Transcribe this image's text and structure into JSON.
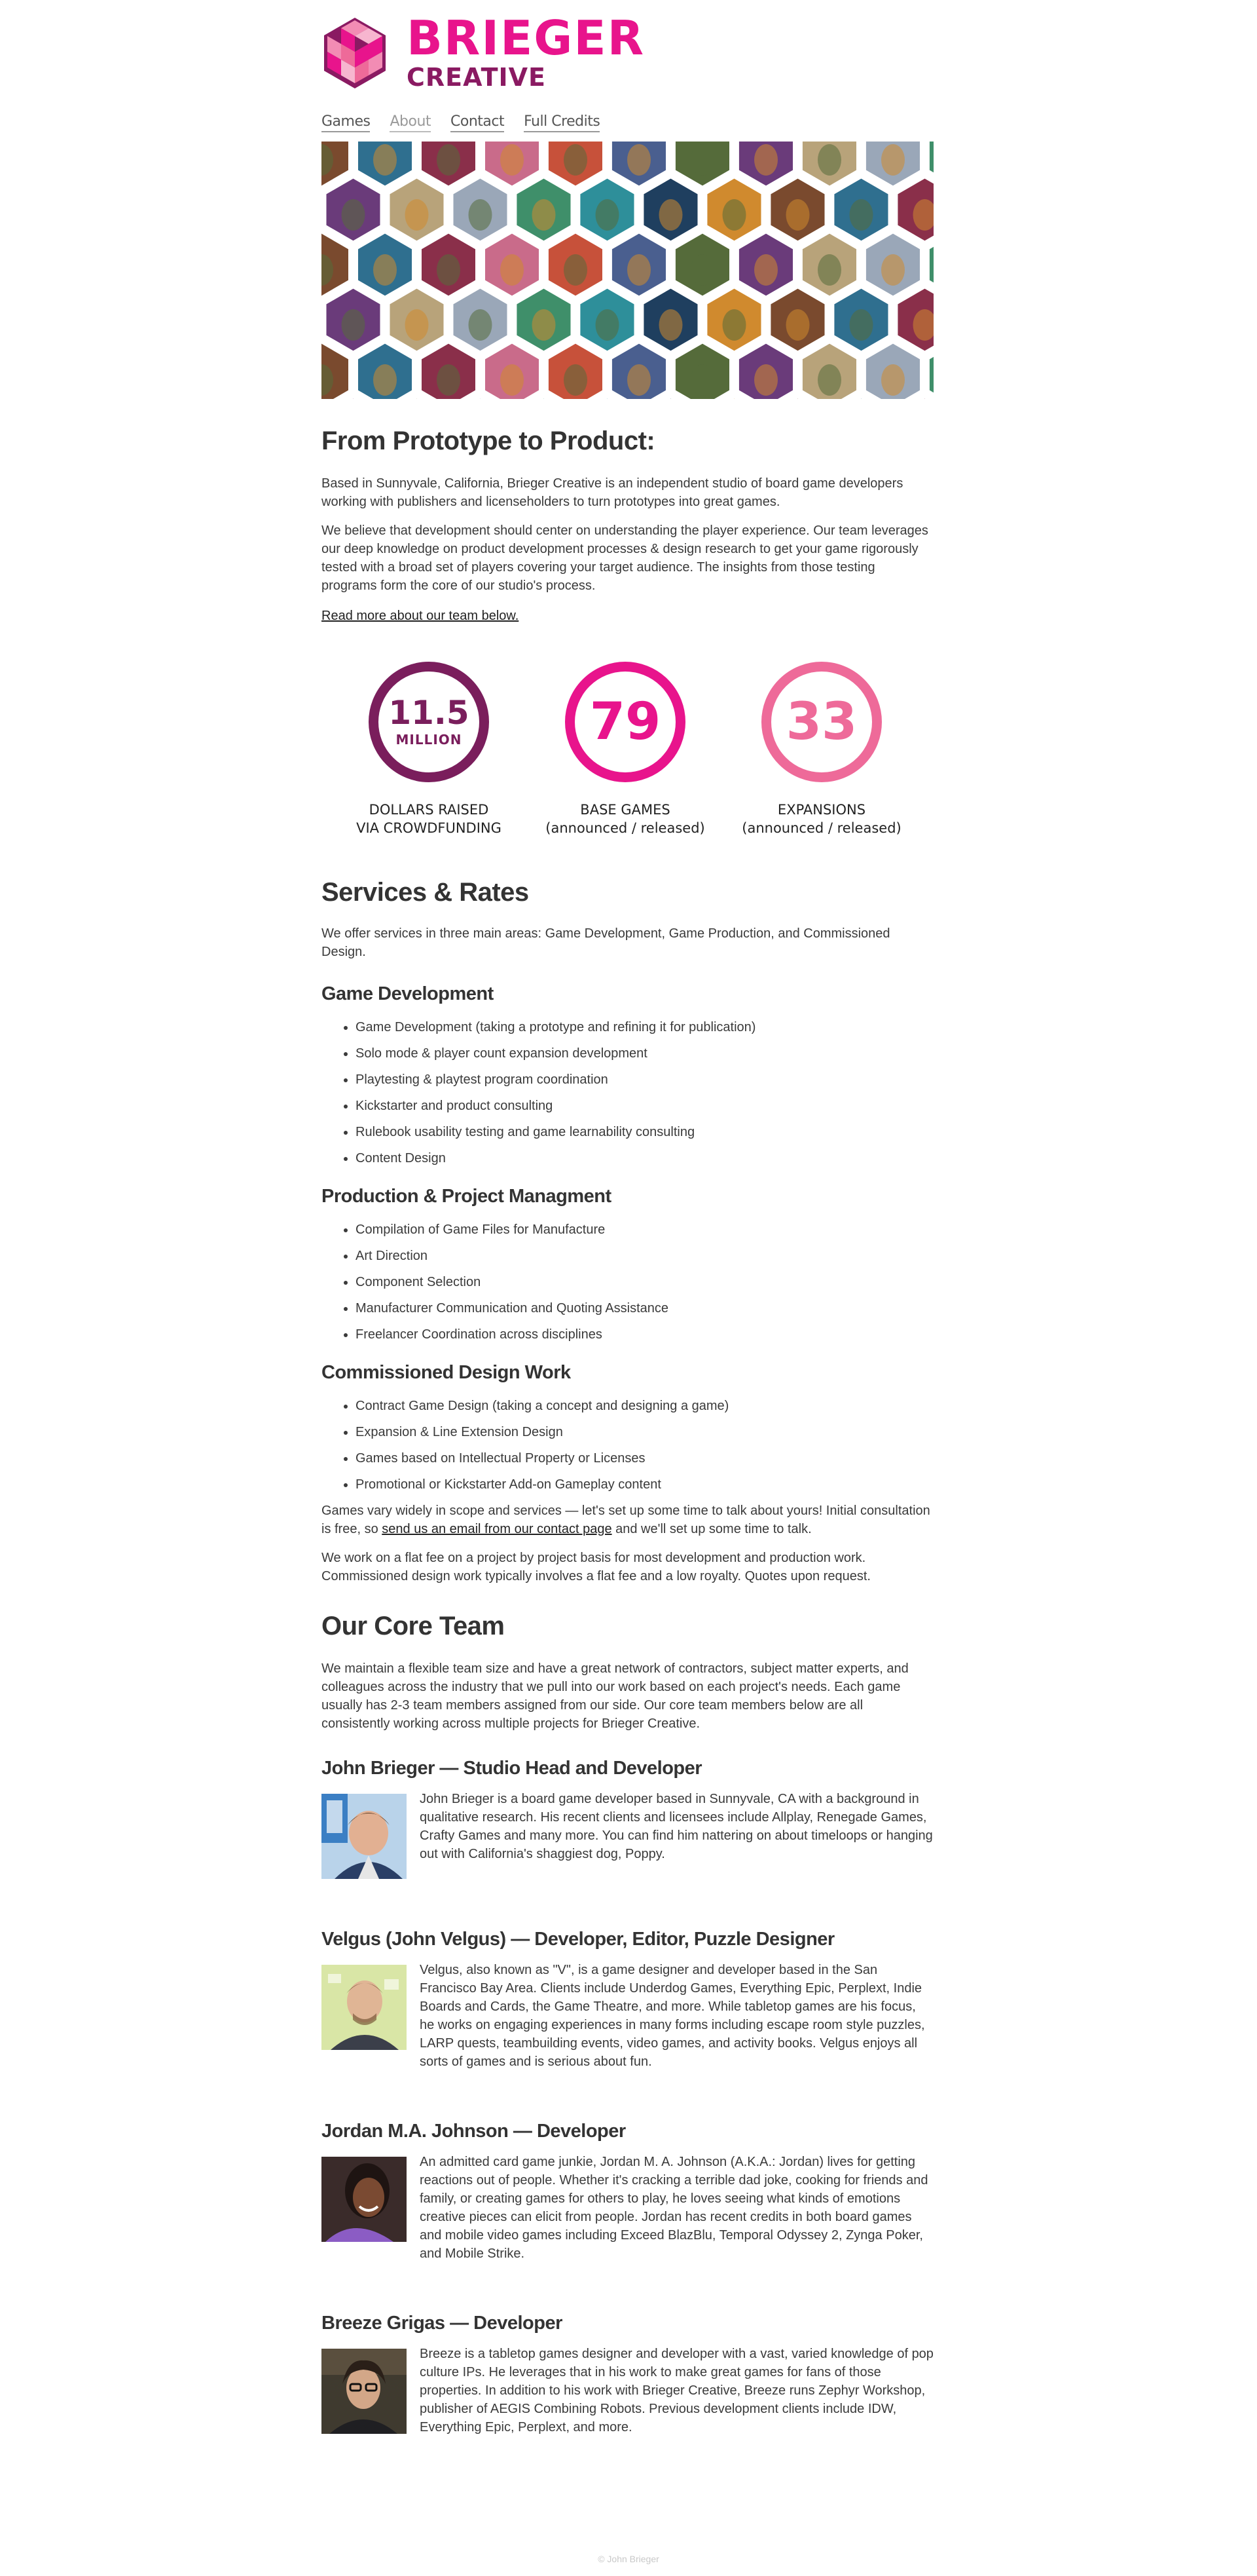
{
  "brand": {
    "name": "BRIEGER",
    "sub": "CREATIVE",
    "primary_color": "#e8148c",
    "secondary_color": "#8a1a62",
    "pink_color": "#ee6a99"
  },
  "nav": {
    "items": [
      {
        "label": "Games"
      },
      {
        "label": "About"
      },
      {
        "label": "Contact"
      },
      {
        "label": "Full Credits"
      }
    ]
  },
  "intro": {
    "heading": "From Prototype to Product:",
    "p1": "Based in Sunnyvale, California, Brieger Creative is an independent studio of board game developers working with publishers and licenseholders to turn prototypes into great games.",
    "p2": "We believe that development should center on understanding the player experience. Our team leverages our deep knowledge on product development processes & design research to get your game rigorously tested with a broad set of players covering your target audience. The insights from those testing programs form the core of our studio's process.",
    "team_link": "Read more about our team below."
  },
  "stats": [
    {
      "number": "11.5",
      "unit": "MILLION",
      "label_line1": "DOLLARS RAISED",
      "label_line2": "VIA CROWDFUNDING",
      "color": "#7a1e5c"
    },
    {
      "number": "79",
      "unit": "",
      "label_line1": "BASE GAMES",
      "label_line2": "(announced / released)",
      "color": "#e8148c"
    },
    {
      "number": "33",
      "unit": "",
      "label_line1": "EXPANSIONS",
      "label_line2": "(announced / released)",
      "color": "#ee6a99"
    }
  ],
  "services": {
    "heading": "Services & Rates",
    "intro": "We offer services in three main areas: Game Development, Game Production, and Commissioned Design.",
    "groups": [
      {
        "title": "Game Development",
        "items": [
          "Game Development (taking a prototype and refining it for publication)",
          "Solo mode & player count expansion development",
          "Playtesting & playtest program coordination",
          "Kickstarter and product consulting",
          "Rulebook usability testing and game learnability consulting",
          "Content Design"
        ]
      },
      {
        "title": "Production & Project Managment",
        "items": [
          "Compilation of Game Files for Manufacture",
          "Art Direction",
          "Component Selection",
          "Manufacturer Communication and Quoting Assistance",
          "Freelancer Coordination across disciplines"
        ]
      },
      {
        "title": "Commissioned Design Work",
        "items": [
          "Contract Game Design (taking a concept and designing a game)",
          "Expansion & Line Extension Design",
          "Games based on Intellectual Property or Licenses",
          "Promotional or Kickstarter Add-on Gameplay content"
        ]
      }
    ],
    "scope_before": "Games vary widely in scope and services — let's set up some time to talk about yours! Initial consultation is free, so ",
    "scope_link": "send us an email from our contact page",
    "scope_after": " and we'll set up some time to talk.",
    "rates": "We work on a flat fee on a project by project basis for most development and production work. Commissioned design work typically involves a flat fee and a low royalty. Quotes upon request."
  },
  "team": {
    "heading": "Our Core Team",
    "intro": "We maintain a flexible team size and have a great network of contractors, subject matter experts, and colleagues across the industry that we pull into our work based on each project's needs. Each game usually has 2-3 team members assigned from our side. Our core team members below are all consistently working across multiple projects for Brieger Creative.",
    "members": [
      {
        "name": "John Brieger — Studio Head and Developer",
        "bio": "John Brieger is a board game developer based in Sunnyvale, CA with a background in qualitative research. His recent clients and licensees include Allplay, Renegade Games, Crafty Games and many more. You can find him nattering on about timeloops or hanging out with California's shaggiest dog, Poppy."
      },
      {
        "name": "Velgus (John Velgus) — Developer, Editor, Puzzle Designer",
        "bio": "Velgus, also known as \"V\", is a game designer and developer based in the San Francisco Bay Area. Clients include Underdog Games, Everything Epic, Perplext, Indie Boards and Cards, the Game Theatre, and more. While tabletop games are his focus, he works on engaging experiences in many forms including escape room style puzzles, LARP quests, teambuilding events, video games, and activity books. Velgus enjoys all sorts of games and is serious about fun."
      },
      {
        "name": "Jordan M.A. Johnson — Developer",
        "bio": "An admitted card game junkie, Jordan M. A. Johnson (A.K.A.: Jordan) lives for getting reactions out of people. Whether it's cracking a terrible dad joke, cooking for friends and family, or creating games for others to play, he loves seeing what kinds of emotions creative pieces can elicit from people. Jordan has recent credits in both board games and mobile video games including Exceed BlazBlu, Temporal Odyssey 2, Zynga Poker, and Mobile Strike."
      },
      {
        "name": "Breeze Grigas — Developer",
        "bio": "Breeze is a tabletop games designer and developer with a vast, varied knowledge of pop culture IPs. He leverages that in his work to make great games for fans of those properties. In addition to his work with Brieger Creative, Breeze runs Zephyr Workshop, publisher of AEGIS Combining Robots. Previous development clients include IDW, Everything Epic, Perplext, and more."
      }
    ]
  },
  "footer": "© John Brieger"
}
